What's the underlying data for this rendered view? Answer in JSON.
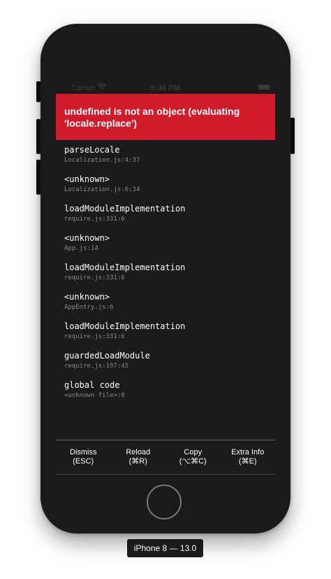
{
  "status_bar": {
    "carrier": "Carrier",
    "time": "6:46 PM"
  },
  "error": {
    "message": "undefined is not an object (evaluating 'locale.replace')"
  },
  "stack_frames": [
    {
      "method": "parseLocale",
      "location": "Localization.js:4:37"
    },
    {
      "method": "<unknown>",
      "location": "Localization.js:6:34"
    },
    {
      "method": "loadModuleImplementation",
      "location": "require.js:331:6"
    },
    {
      "method": "<unknown>",
      "location": "App.js:14"
    },
    {
      "method": "loadModuleImplementation",
      "location": "require.js:331:6"
    },
    {
      "method": "<unknown>",
      "location": "AppEntry.js:6"
    },
    {
      "method": "loadModuleImplementation",
      "location": "require.js:331:6"
    },
    {
      "method": "guardedLoadModule",
      "location": "require.js:197:45"
    },
    {
      "method": "global code",
      "location": "<unknown file>:0"
    }
  ],
  "footer": {
    "dismiss": {
      "label": "Dismiss",
      "shortcut": "(ESC)"
    },
    "reload": {
      "label": "Reload",
      "shortcut": "(⌘R)"
    },
    "copy": {
      "label": "Copy",
      "shortcut": "(⌥⌘C)"
    },
    "extra_info": {
      "label": "Extra Info",
      "shortcut": "(⌘E)"
    }
  },
  "device_label": "iPhone 8 — 13.0",
  "colors": {
    "error_banner": "#d01c2a",
    "screen_background": "#1b1b1b",
    "device_body": "#1a1a1c"
  }
}
